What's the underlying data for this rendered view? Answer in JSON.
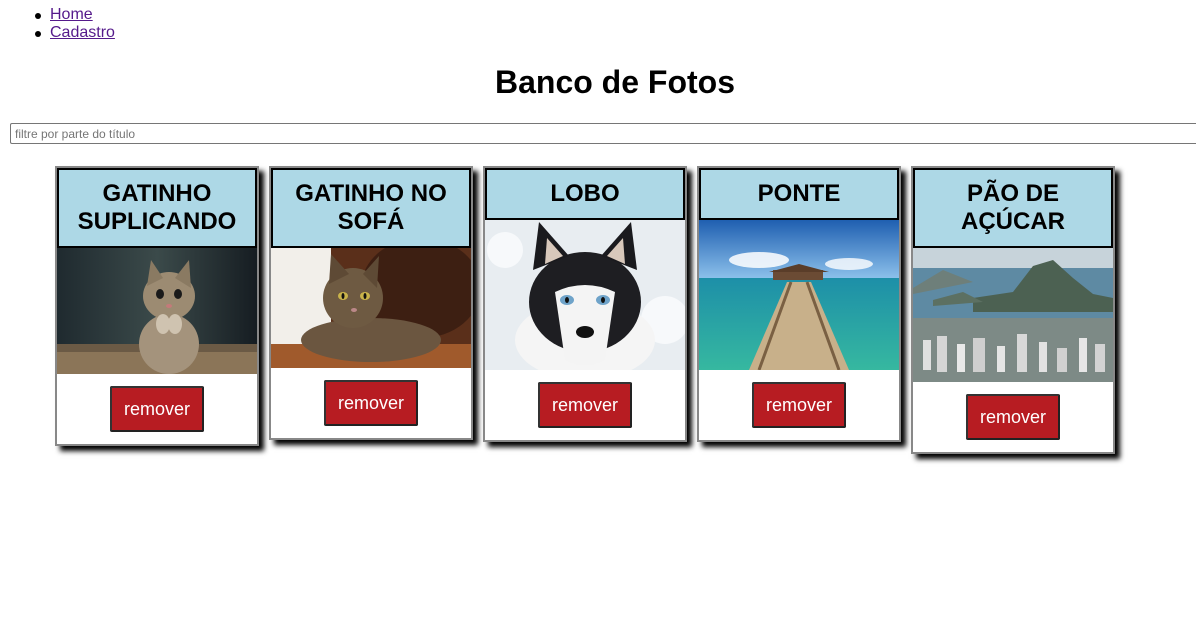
{
  "nav": {
    "items": [
      {
        "label": "Home"
      },
      {
        "label": "Cadastro"
      }
    ]
  },
  "page": {
    "title": "Banco de Fotos"
  },
  "filter": {
    "placeholder": "filtre por parte do título",
    "value": ""
  },
  "cards": [
    {
      "title": "GATINHO SUPLICANDO",
      "remove_label": "remover"
    },
    {
      "title": "GATINHO NO SOFÁ",
      "remove_label": "remover"
    },
    {
      "title": "LOBO",
      "remove_label": "remover"
    },
    {
      "title": "PONTE",
      "remove_label": "remover"
    },
    {
      "title": "PÃO DE AÇÚCAR",
      "remove_label": "remover"
    }
  ],
  "colors": {
    "header_bg": "#add8e6",
    "button_bg": "#b71c22",
    "link": "#551a8b"
  }
}
